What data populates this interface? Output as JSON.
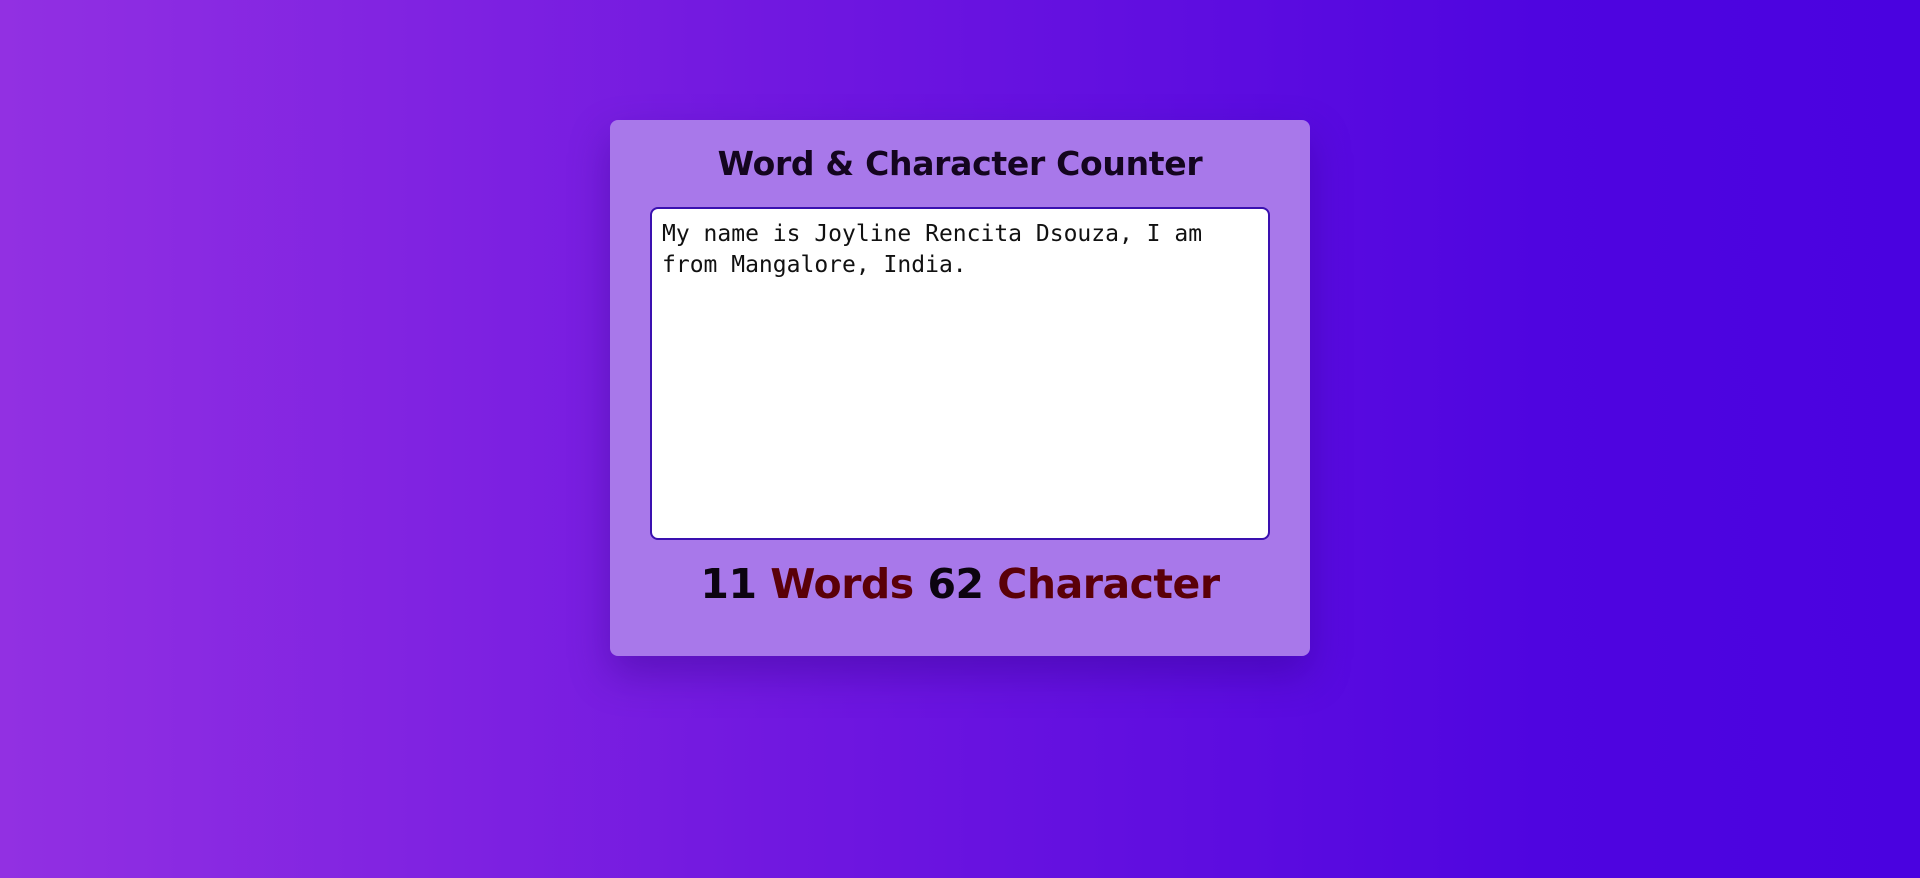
{
  "counter": {
    "title": "Word & Character Counter",
    "text": "My name is Joyline Rencita Dsouza, I am from Mangalore, India.",
    "word_count": "11",
    "word_label": "Words",
    "char_count": "62",
    "char_label": "Character"
  },
  "colors": {
    "background_start": "#9230e2",
    "background_end": "#4a02e0",
    "card": "#a878ea",
    "count_number": "#0c0410",
    "count_label": "#5a0008"
  }
}
